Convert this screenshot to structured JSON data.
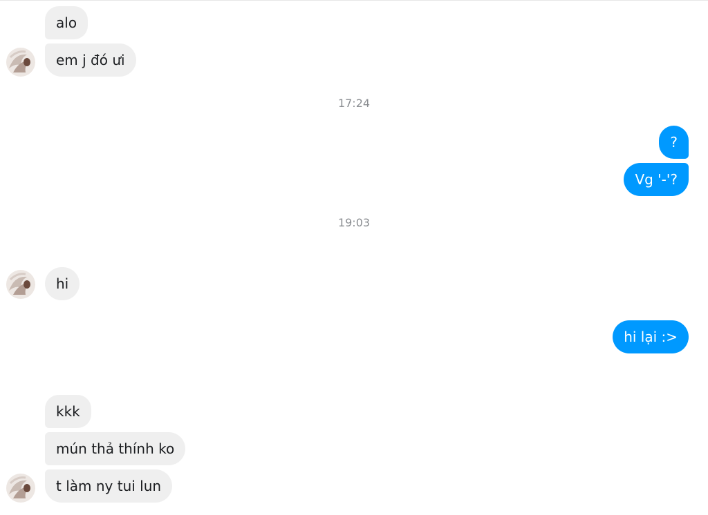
{
  "colors": {
    "incoming_bubble": "#efefef",
    "outgoing_bubble": "#0099ff",
    "timestamp_text": "#8a8d91"
  },
  "messages": {
    "m1": "alo",
    "m2": "em j đó ưi",
    "t1": "17:24",
    "m3": "?",
    "m4": "Vg '-'?",
    "t2": "19:03",
    "m5": "hi",
    "m6": "hi lại :>",
    "m7": "kkk",
    "m8": "mún thả thính ko",
    "m9": "t làm ny tui lun"
  },
  "avatar": {
    "icon": "contact-avatar-icon"
  }
}
